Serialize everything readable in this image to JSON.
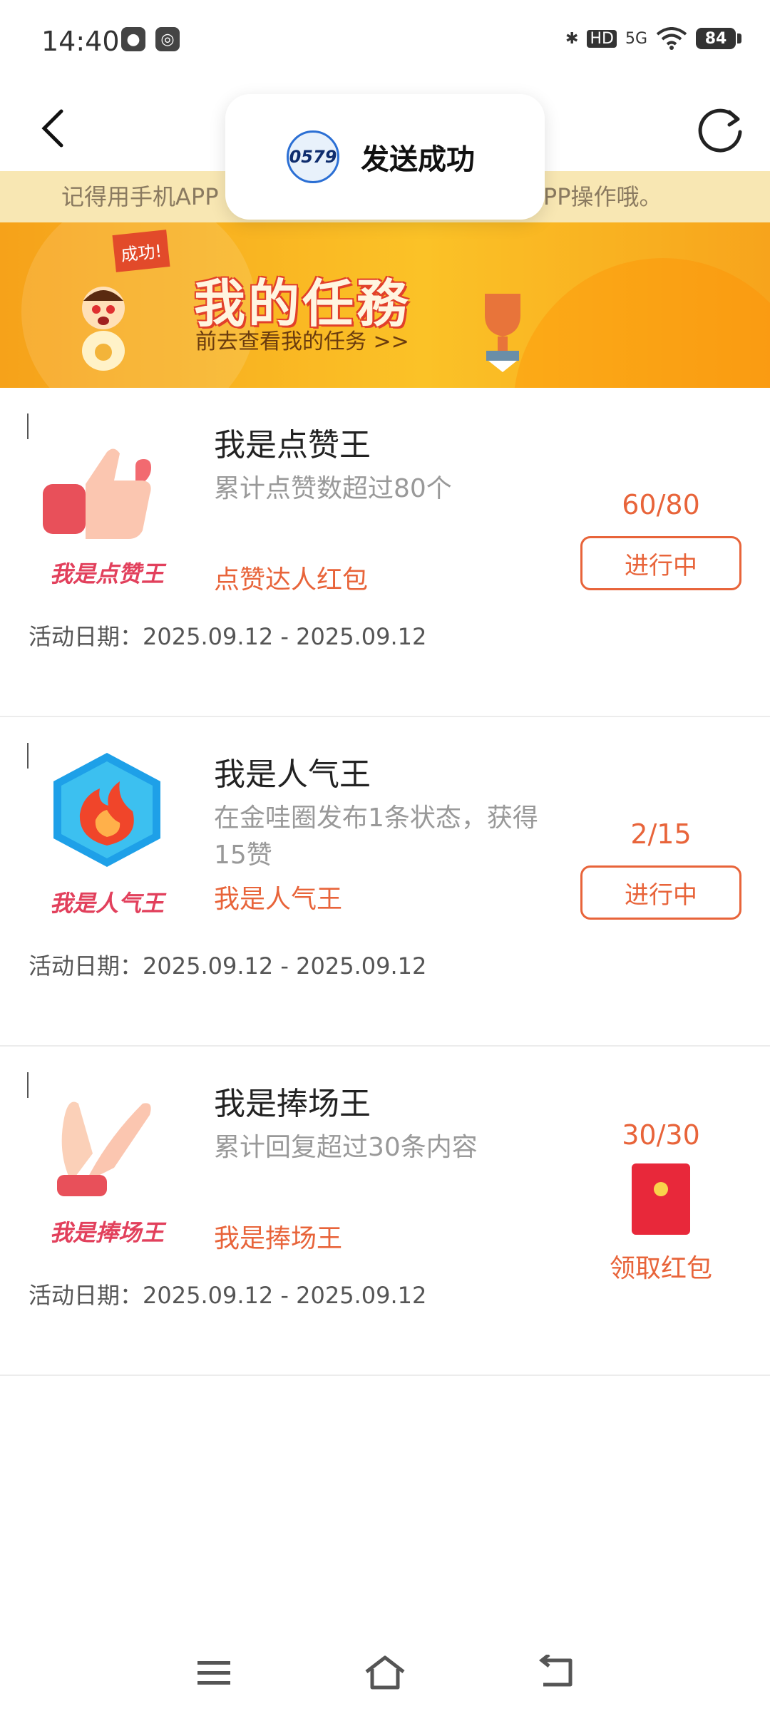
{
  "status_bar": {
    "time": "14:40",
    "network": "5G",
    "hd": "HD",
    "battery": "84"
  },
  "header": {
    "back_icon": "chevron-left-icon",
    "refresh_icon": "refresh-icon"
  },
  "toast": {
    "logo_text": "0579",
    "message": "发送成功"
  },
  "notice": {
    "text_left": "记得用手机APP",
    "text_right": "机APP操作哦。"
  },
  "banner": {
    "flag": "成功!",
    "title": "我的任務",
    "subtitle": "前去查看我的任务 >>"
  },
  "tasks": [
    {
      "image_label": "我是点赞王",
      "title": "我是点赞王",
      "description": "累计点赞数超过80个",
      "reward": "点赞达人红包",
      "date": "活动日期：2025.09.12 - 2025.09.12",
      "progress": "60/80",
      "action": "进行中"
    },
    {
      "image_label": "我是人气王",
      "title": "我是人气王",
      "description": "在金哇圈发布1条状态，获得15赞",
      "reward": "我是人气王",
      "date": "活动日期：2025.09.12 - 2025.09.12",
      "progress": "2/15",
      "action": "进行中"
    },
    {
      "image_label": "我是捧场王",
      "title": "我是捧场王",
      "description": "累计回复超过30条内容",
      "reward": "我是捧场王",
      "date": "活动日期：2025.09.12 - 2025.09.12",
      "progress": "30/30",
      "action": "领取红包"
    }
  ],
  "nav": {
    "menu_icon": "menu-icon",
    "home_icon": "home-icon",
    "back_icon": "back-icon"
  },
  "colors": {
    "accent": "#e8643a",
    "notice_bg": "#f8e7b3",
    "banner": "#fbc227"
  }
}
